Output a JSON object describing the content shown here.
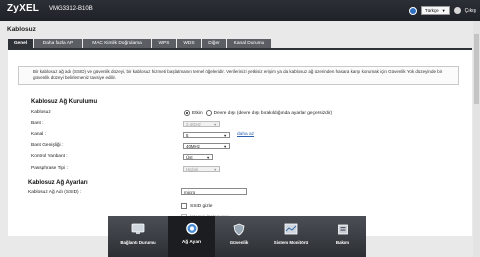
{
  "header": {
    "brand": "ZyXEL",
    "model": "VMG3312-B10B",
    "language": "Türkçe",
    "logout": "Çıkış"
  },
  "page": {
    "title": "Kablosuz",
    "tabs": [
      {
        "label": "Genel"
      },
      {
        "label": "Daha fazla AP"
      },
      {
        "label": "MAC Kimlik Doğrulama"
      },
      {
        "label": "WPS"
      },
      {
        "label": "WDS"
      },
      {
        "label": "Diğer"
      },
      {
        "label": "Kanal Durumu"
      }
    ],
    "notice": "Bir kablosuz ağ adı (SSID) ve güvenlik düzeyi, bir kablosuz hizmeti başlatmanın temel öğeleridir. Verilerinizi yetkisiz erişim ya da kablosuz ağ üzerinden hasara karşı korumak için Güvenlik Yok düzeyinde bir güvenlik düzeyi belirlemeniz tavsiye edilir."
  },
  "setup": {
    "title": "Kablosuz Ağ Kurulumu",
    "wireless_label": "Kablosuz",
    "wireless_on": "Etkin",
    "wireless_off": "Devre dışı (devre dışı bırakıldığında ayarlar geçersizdir)",
    "band_label": "Bant :",
    "band_value": "2.4GHz",
    "channel_label": "Kanal :",
    "channel_value": "5",
    "channel_more": "daha az",
    "bandwidth_label": "Bant Genişliği :",
    "bandwidth_value": "40MHz",
    "control_label": "Kontrol Yanbant :",
    "control_value": "Üst",
    "passphrase_label": "Passphrase Tipi :",
    "passphrase_value": "Hiçbiri"
  },
  "settings": {
    "title": "Kablosuz Ağ Ayarları",
    "ssid_label": "Kablosuz Ağ Adı (SSID) :",
    "ssid_value": "micro",
    "hide_ssid": "SSID gizle",
    "next_option": "İstemci İzolasyonu"
  },
  "dock": {
    "items": [
      {
        "label": "Bağlantı Durumu"
      },
      {
        "label": "Ağ Ayarı"
      },
      {
        "label": "Güvenlik"
      },
      {
        "label": "Sistem Monitörü"
      },
      {
        "label": "Bakım"
      }
    ]
  }
}
